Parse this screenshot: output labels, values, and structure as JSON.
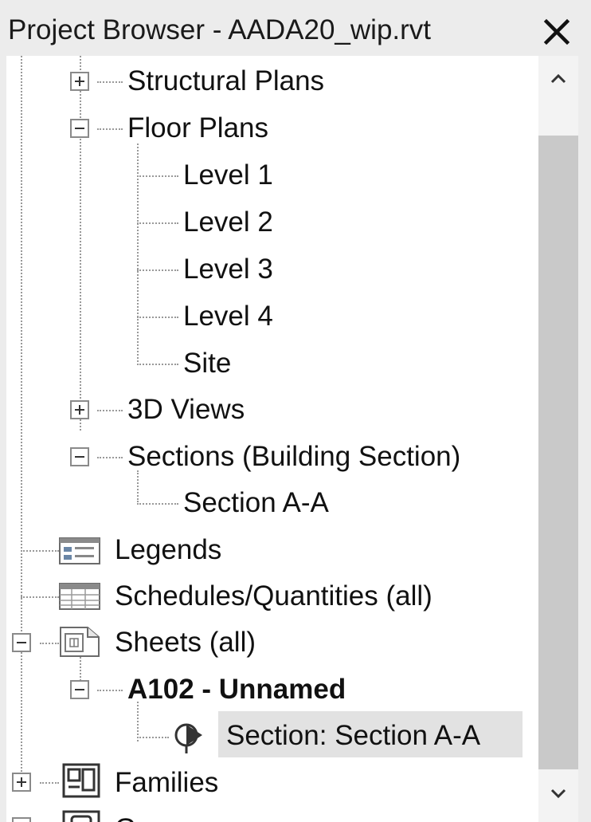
{
  "window": {
    "title": "Project Browser - AADA20_wip.rvt"
  },
  "tree": {
    "structural_plans": "Structural Plans",
    "floor_plans": "Floor Plans",
    "level_1": "Level 1",
    "level_2": "Level 2",
    "level_3": "Level 3",
    "level_4": "Level 4",
    "site": "Site",
    "views_3d": "3D Views",
    "sections": "Sections (Building Section)",
    "section_aa": "Section A-A",
    "legends": "Legends",
    "schedules": "Schedules/Quantities (all)",
    "sheets": "Sheets (all)",
    "sheet_a102": "A102 - Unnamed",
    "sheet_section": "Section: Section A-A",
    "families": "Families",
    "groups_partial": "G"
  },
  "icons": {
    "close": "close-icon",
    "expand": "plus-box-icon",
    "collapse": "minus-box-icon",
    "legend": "legend-icon",
    "schedule": "schedule-icon",
    "sheet": "sheet-icon",
    "section_view": "section-view-icon",
    "family": "family-icon",
    "group": "group-icon",
    "scroll_up": "chevron-up-icon",
    "scroll_down": "chevron-down-icon"
  },
  "colors": {
    "selected_row": "#e2e2e2",
    "panel_bg": "#ececec",
    "tree_bg": "#ffffff",
    "scroll_thumb": "#c9c9c9"
  }
}
